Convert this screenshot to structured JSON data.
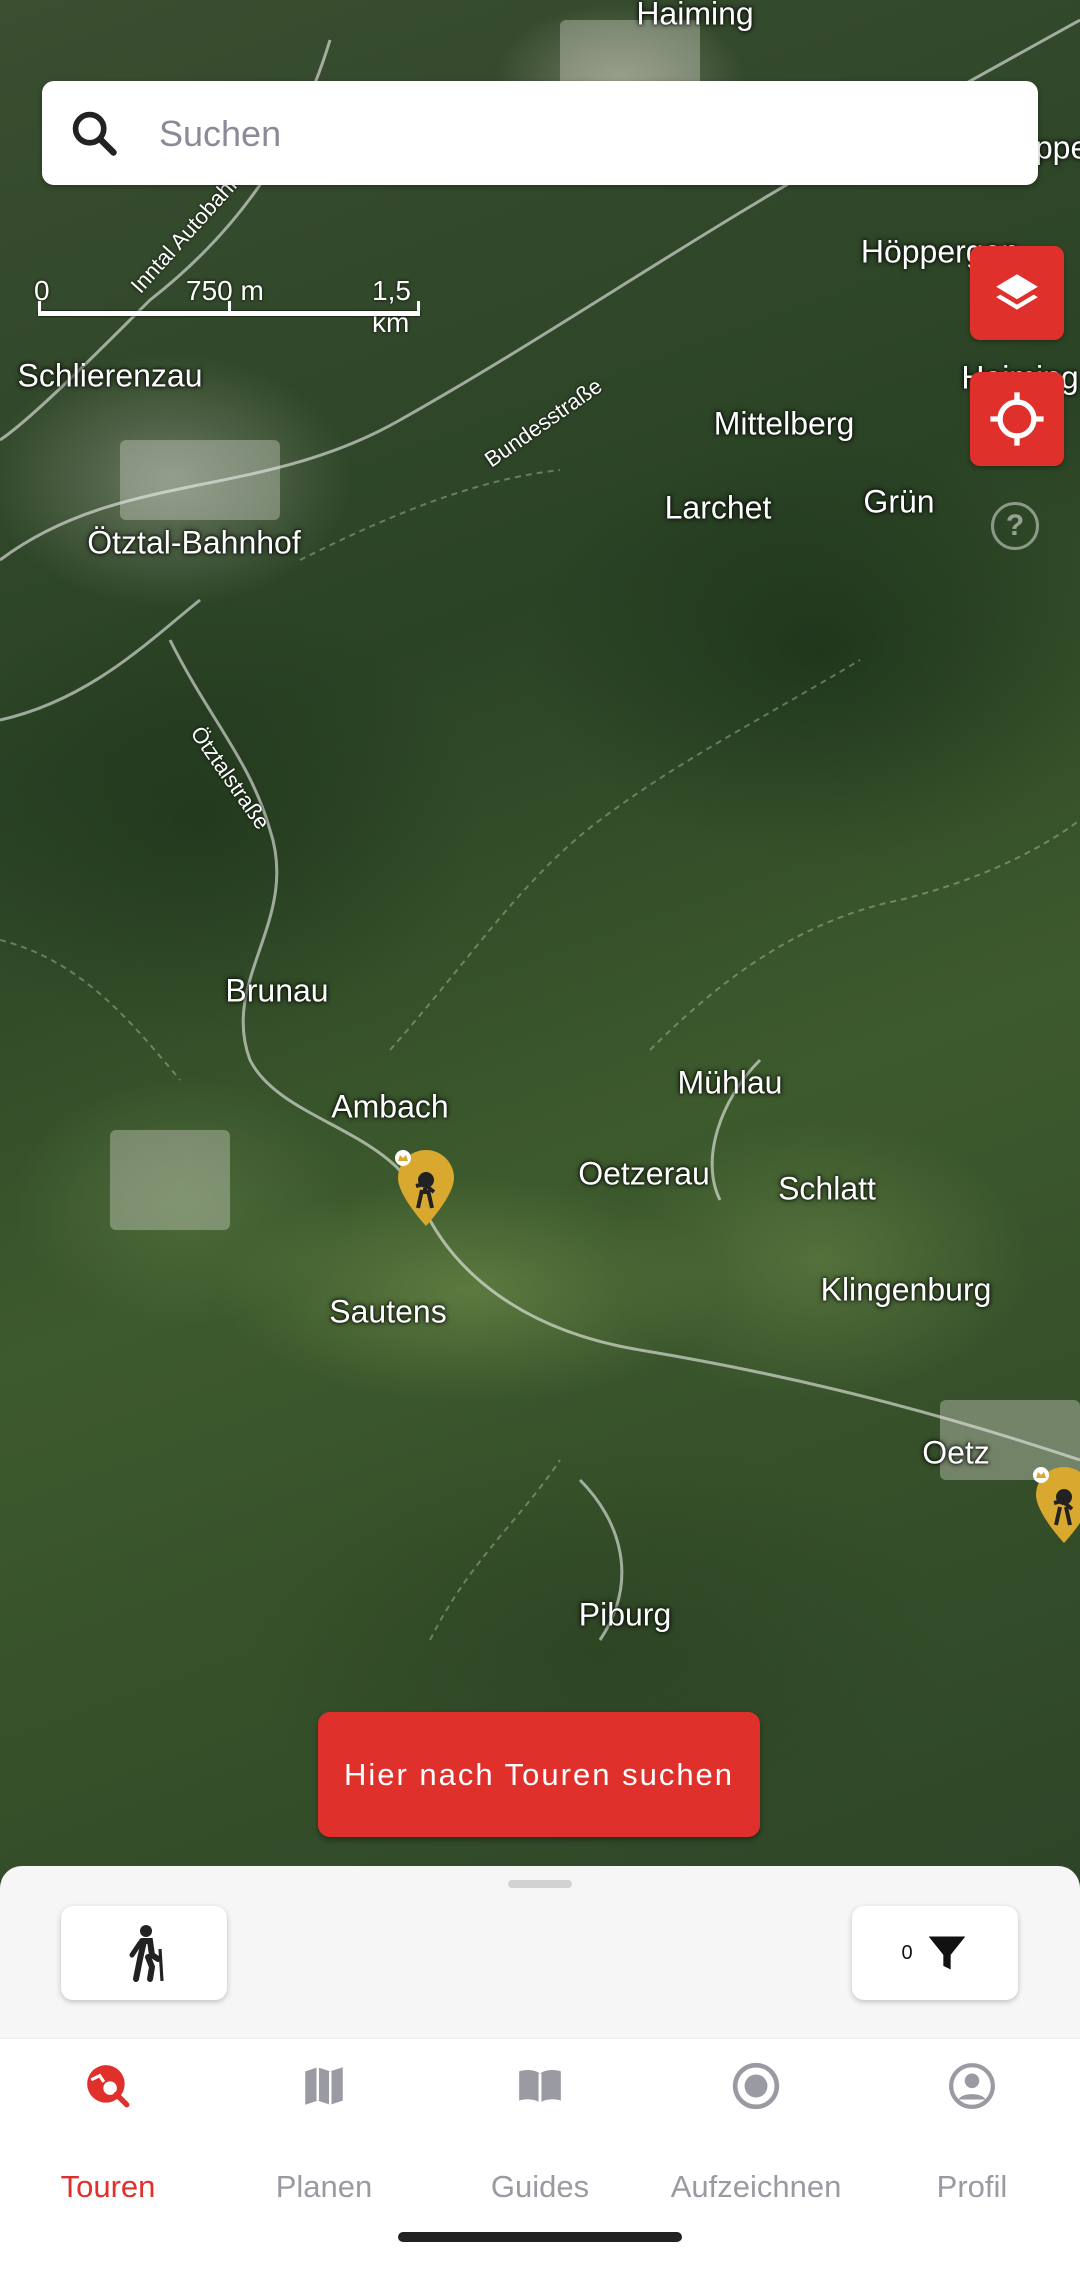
{
  "search": {
    "placeholder": "Suchen"
  },
  "scale": {
    "zero": "0",
    "mid": "750 m",
    "max": "1,5 km"
  },
  "map": {
    "places": [
      "Haiming",
      "Roppen",
      "Schlierenzau",
      "Höppergen",
      "Haiming",
      "Mittelberg",
      "Larchet",
      "Grün",
      "Ötztal-Bahnhof",
      "Brunau",
      "Ambach",
      "Mühlau",
      "Oetzerau",
      "Schlatt",
      "Sautens",
      "Klingenburg",
      "Oetz",
      "Piburg"
    ],
    "roads": [
      "Inntal Autobahn",
      "Bundesstraße",
      "Ötztalstraße"
    ]
  },
  "controls": {
    "layers_icon": "layers-icon",
    "locate_icon": "locate-icon",
    "help_icon": "help-icon",
    "help_label": "?"
  },
  "search_here": "Hier nach Touren suchen",
  "sheet": {
    "activity_icon": "hiking-icon",
    "filter_count": "0",
    "filter_icon": "filter-icon"
  },
  "tabs": [
    {
      "label": "Touren",
      "icon": "tour-search-icon",
      "active": true
    },
    {
      "label": "Planen",
      "icon": "map-icon",
      "active": false
    },
    {
      "label": "Guides",
      "icon": "book-icon",
      "active": false
    },
    {
      "label": "Aufzeichnen",
      "icon": "record-icon",
      "active": false
    },
    {
      "label": "Profil",
      "icon": "profile-icon",
      "active": false
    }
  ],
  "colors": {
    "accent": "#e0302b",
    "pin": "#d9a82e",
    "tab_inactive": "#9a9aa2"
  }
}
